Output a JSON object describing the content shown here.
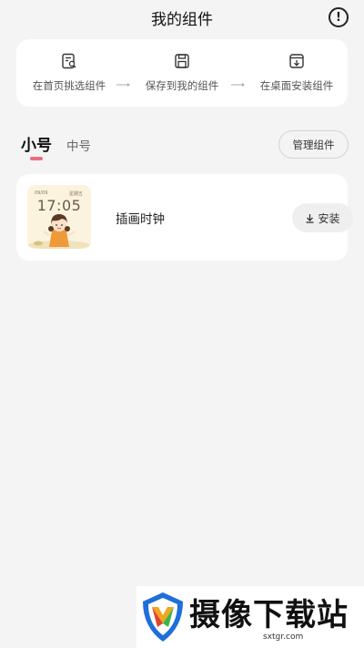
{
  "header": {
    "title": "我的组件",
    "info_icon": "exclamation-circle-icon",
    "info_glyph": "!"
  },
  "steps": [
    {
      "label": "在首页挑选组件",
      "icon": "search-document-icon"
    },
    {
      "label": "保存到我的组件",
      "icon": "save-floppy-icon"
    },
    {
      "label": "在桌面安装组件",
      "icon": "download-box-icon"
    }
  ],
  "tabs": {
    "small": "小号",
    "medium": "中号",
    "manage_button": "管理组件"
  },
  "widgets": [
    {
      "name": "插画时钟",
      "install_label": "安装",
      "thumbnail": {
        "date": "09/09",
        "weekday": "星期五",
        "time": "17:05"
      }
    }
  ],
  "watermark": {
    "text": "摄像下载站",
    "url": "sxtgr.com"
  },
  "colors": {
    "background": "#f4f4f4",
    "card": "#ffffff",
    "tab_indicator": "#e8707a"
  }
}
